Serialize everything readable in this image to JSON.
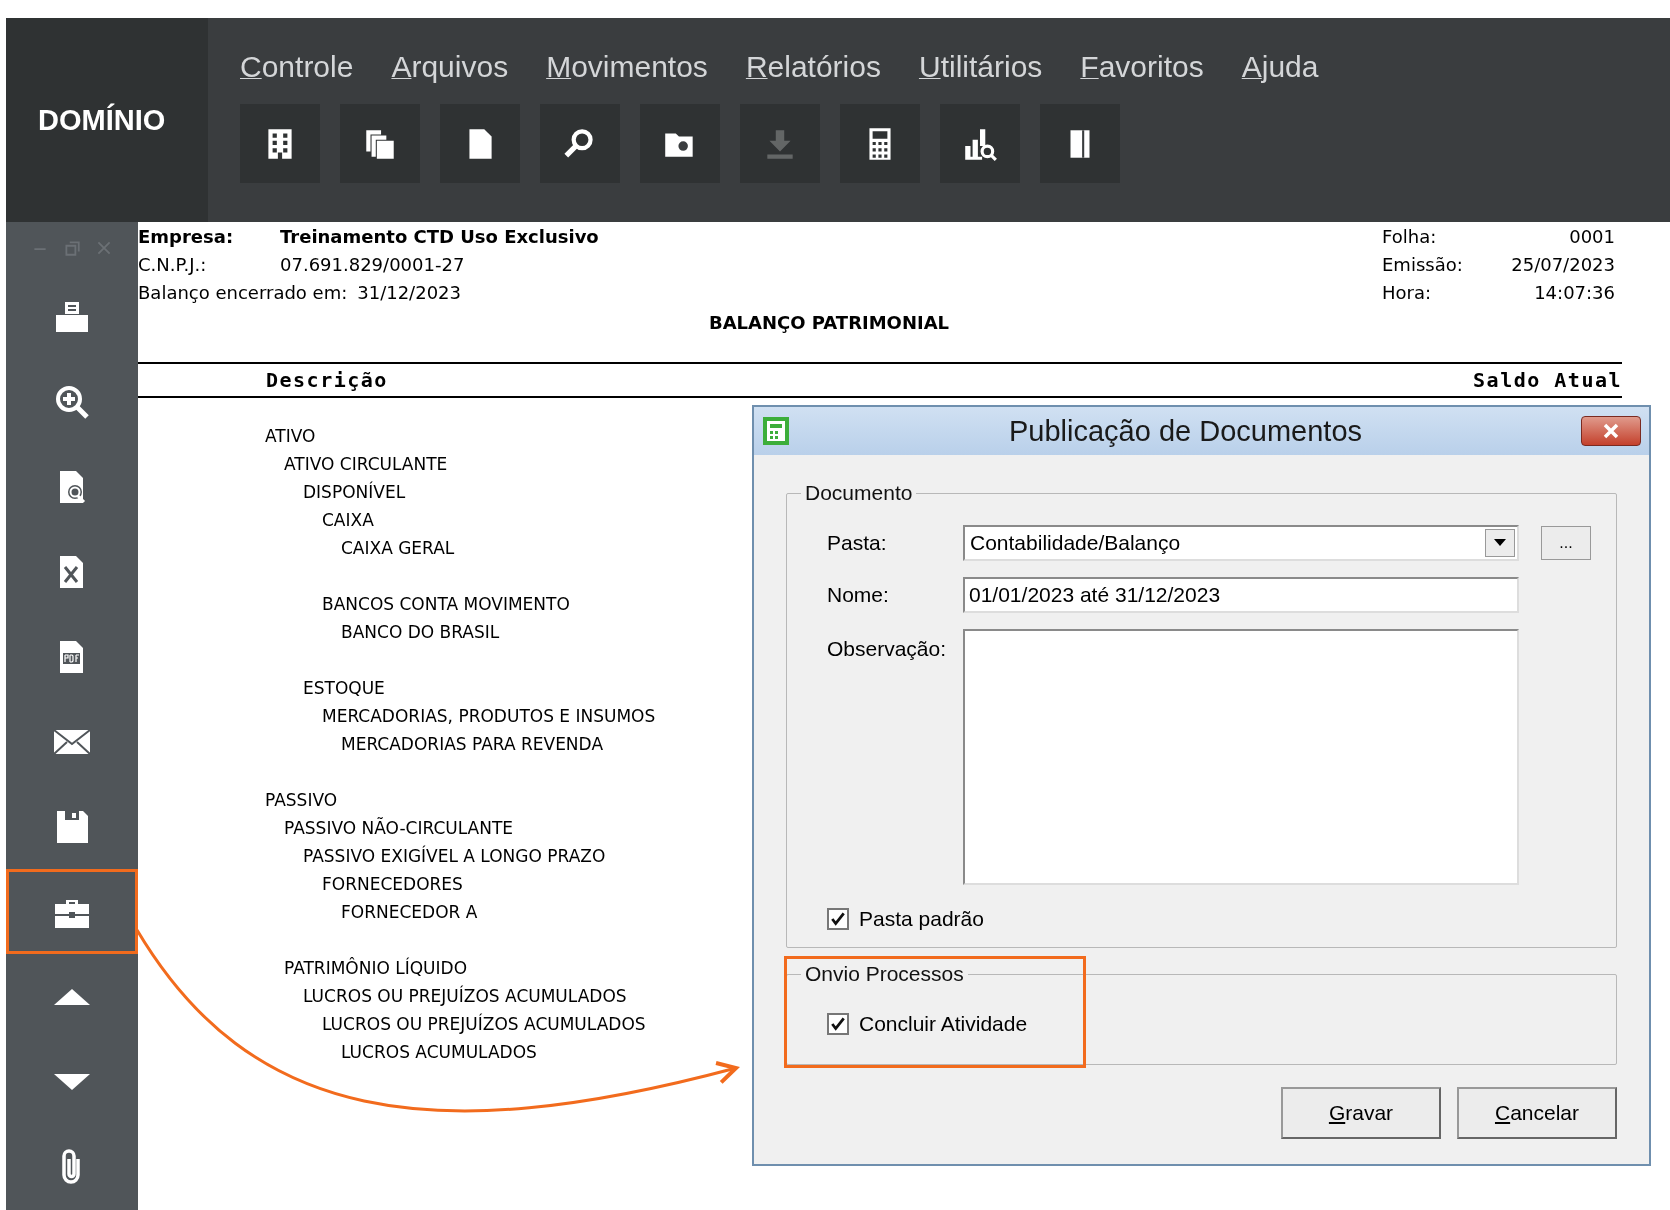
{
  "logo": "DOMÍNIO",
  "menu": [
    "Controle",
    "Arquivos",
    "Movimentos",
    "Relatórios",
    "Utilitários",
    "Favoritos",
    "Ajuda"
  ],
  "toolbar": [
    {
      "disabled": false
    },
    {
      "disabled": false
    },
    {
      "disabled": false
    },
    {
      "disabled": false
    },
    {
      "disabled": false
    },
    {
      "disabled": true
    },
    {
      "disabled": false
    },
    {
      "disabled": false
    },
    {
      "disabled": false
    }
  ],
  "sidebar": {
    "tools": [
      {
        "selected": false
      },
      {
        "selected": false
      },
      {
        "selected": false
      },
      {
        "selected": false
      },
      {
        "selected": false
      },
      {
        "selected": false
      },
      {
        "selected": false
      },
      {
        "selected": true
      },
      {
        "selected": false
      },
      {
        "selected": false
      },
      {
        "selected": false
      }
    ]
  },
  "report": {
    "header_left": [
      {
        "label": "Empresa:",
        "value": "Treinamento CTD Uso Exclusivo",
        "emphasis": true
      },
      {
        "label": "C.N.P.J.:",
        "value": "07.691.829/0001-27",
        "emphasis": false
      },
      {
        "label": "Balanço encerrado em:",
        "value": "31/12/2023",
        "emphasis": false
      }
    ],
    "header_right": [
      {
        "label": "Folha:",
        "value": "0001"
      },
      {
        "label": "Emissão:",
        "value": "25/07/2023"
      },
      {
        "label": "Hora:",
        "value": "14:07:36"
      }
    ],
    "title": "BALANÇO PATRIMONIAL",
    "columns": [
      "Descrição",
      "Saldo Atual"
    ],
    "accounts": [
      {
        "name": "ATIVO",
        "children": [
          {
            "name": "ATIVO CIRCULANTE",
            "children": [
              {
                "name": "DISPONÍVEL",
                "children": [
                  {
                    "name": "CAIXA",
                    "children": [
                      {
                        "name": "CAIXA GERAL"
                      }
                    ]
                  },
                  {
                    "name": "BANCOS CONTA MOVIMENTO",
                    "children": [
                      {
                        "name": "BANCO DO BRASIL"
                      }
                    ]
                  }
                ]
              },
              {
                "name": "ESTOQUE",
                "children": [
                  {
                    "name": "MERCADORIAS, PRODUTOS E INSUMOS",
                    "children": [
                      {
                        "name": "MERCADORIAS PARA REVENDA"
                      }
                    ]
                  }
                ]
              }
            ]
          }
        ]
      },
      {
        "name": "PASSIVO",
        "children": [
          {
            "name": "PASSIVO NÃO-CIRCULANTE",
            "children": [
              {
                "name": "PASSIVO EXIGÍVEL A LONGO PRAZO",
                "children": [
                  {
                    "name": "FORNECEDORES",
                    "children": [
                      {
                        "name": "FORNECEDOR A"
                      }
                    ]
                  }
                ]
              }
            ]
          },
          {
            "name": "PATRIMÔNIO LÍQUIDO",
            "children": [
              {
                "name": "LUCROS OU PREJUÍZOS ACUMULADOS",
                "children": [
                  {
                    "name": "LUCROS OU PREJUÍZOS ACUMULADOS",
                    "children": [
                      {
                        "name": "LUCROS ACUMULADOS"
                      }
                    ]
                  }
                ]
              }
            ]
          }
        ]
      }
    ]
  },
  "dialog": {
    "title": "Publicação de Documentos",
    "documento": {
      "legend": "Documento",
      "pasta": {
        "label": "Pasta:",
        "value": "Contabilidade/Balanço"
      },
      "browse_button": "...",
      "nome": {
        "label": "Nome:",
        "value": "01/01/2023 até 31/12/2023"
      },
      "observacao": {
        "label": "Observação:"
      },
      "checkbox": {
        "label": "Pasta padrão",
        "checked": true
      }
    },
    "onvio": {
      "legend": "Onvio Processos",
      "highlighted": true,
      "checkbox": {
        "label": "Concluir Atividade",
        "checked": true
      }
    },
    "buttons": [
      "Gravar",
      "Cancelar"
    ]
  }
}
